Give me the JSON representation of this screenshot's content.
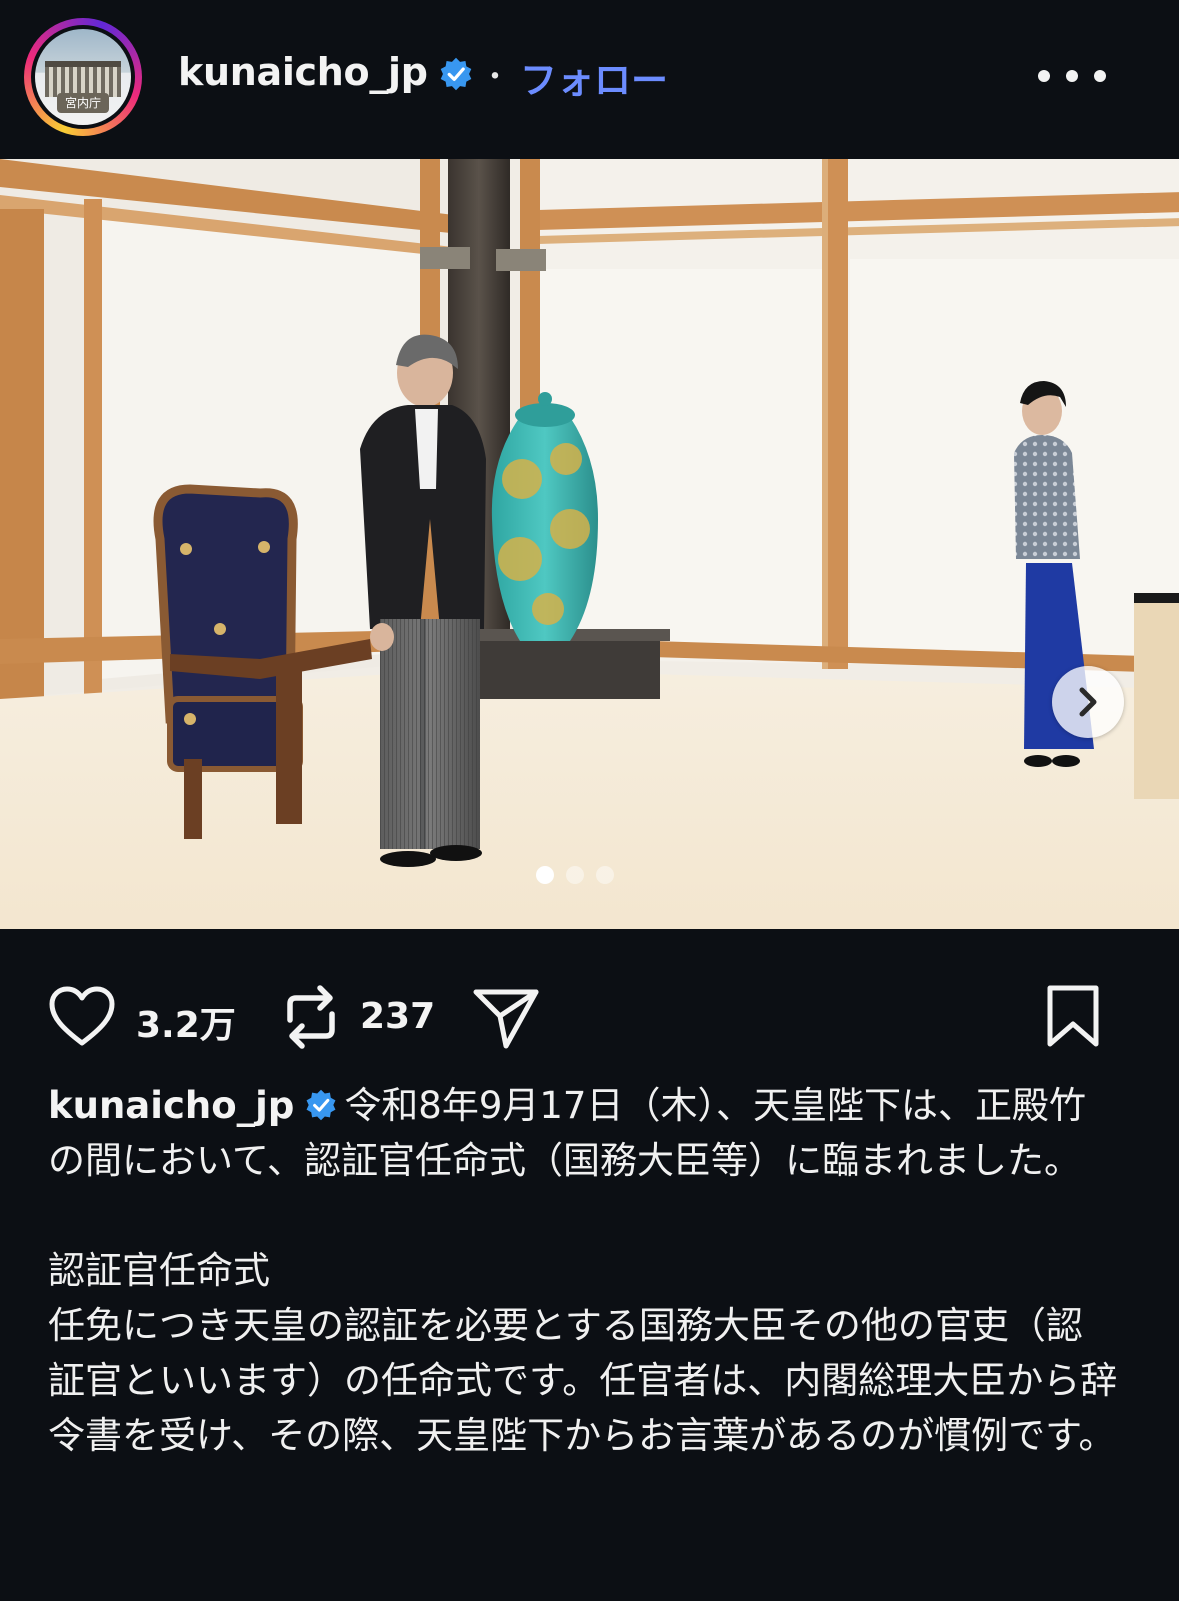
{
  "post": {
    "username": "kunaicho_jp",
    "follow_label": "フォロー",
    "separator": "・",
    "avatar_text": "宮内庁"
  },
  "photo": {
    "carousel": {
      "slide_count": 3,
      "active_index": 0
    }
  },
  "actions": {
    "likes": "3.2万",
    "reposts": "237"
  },
  "caption": {
    "username": "kunaicho_jp",
    "text": "令和8年9月17日（木）、天皇陛下は、正殿竹の間において、認証官任命式（国務大臣等）に臨まれました。",
    "heading": "認証官任命式",
    "body": "任免につき天皇の認証を必要とする国務大臣その他の官吏（認証官といいます）の任命式です。任官者は、内閣総理大臣から辞令書を受け、その際、天皇陛下からお言葉があるのが慣例です。"
  },
  "colors": {
    "background": "#0c0f14",
    "follow": "#6c8cff",
    "verified": "#3897f0"
  },
  "icons": [
    "more-icon",
    "verified-icon",
    "heart-icon",
    "repost-icon",
    "send-icon",
    "bookmark-icon",
    "chevron-right-icon"
  ]
}
